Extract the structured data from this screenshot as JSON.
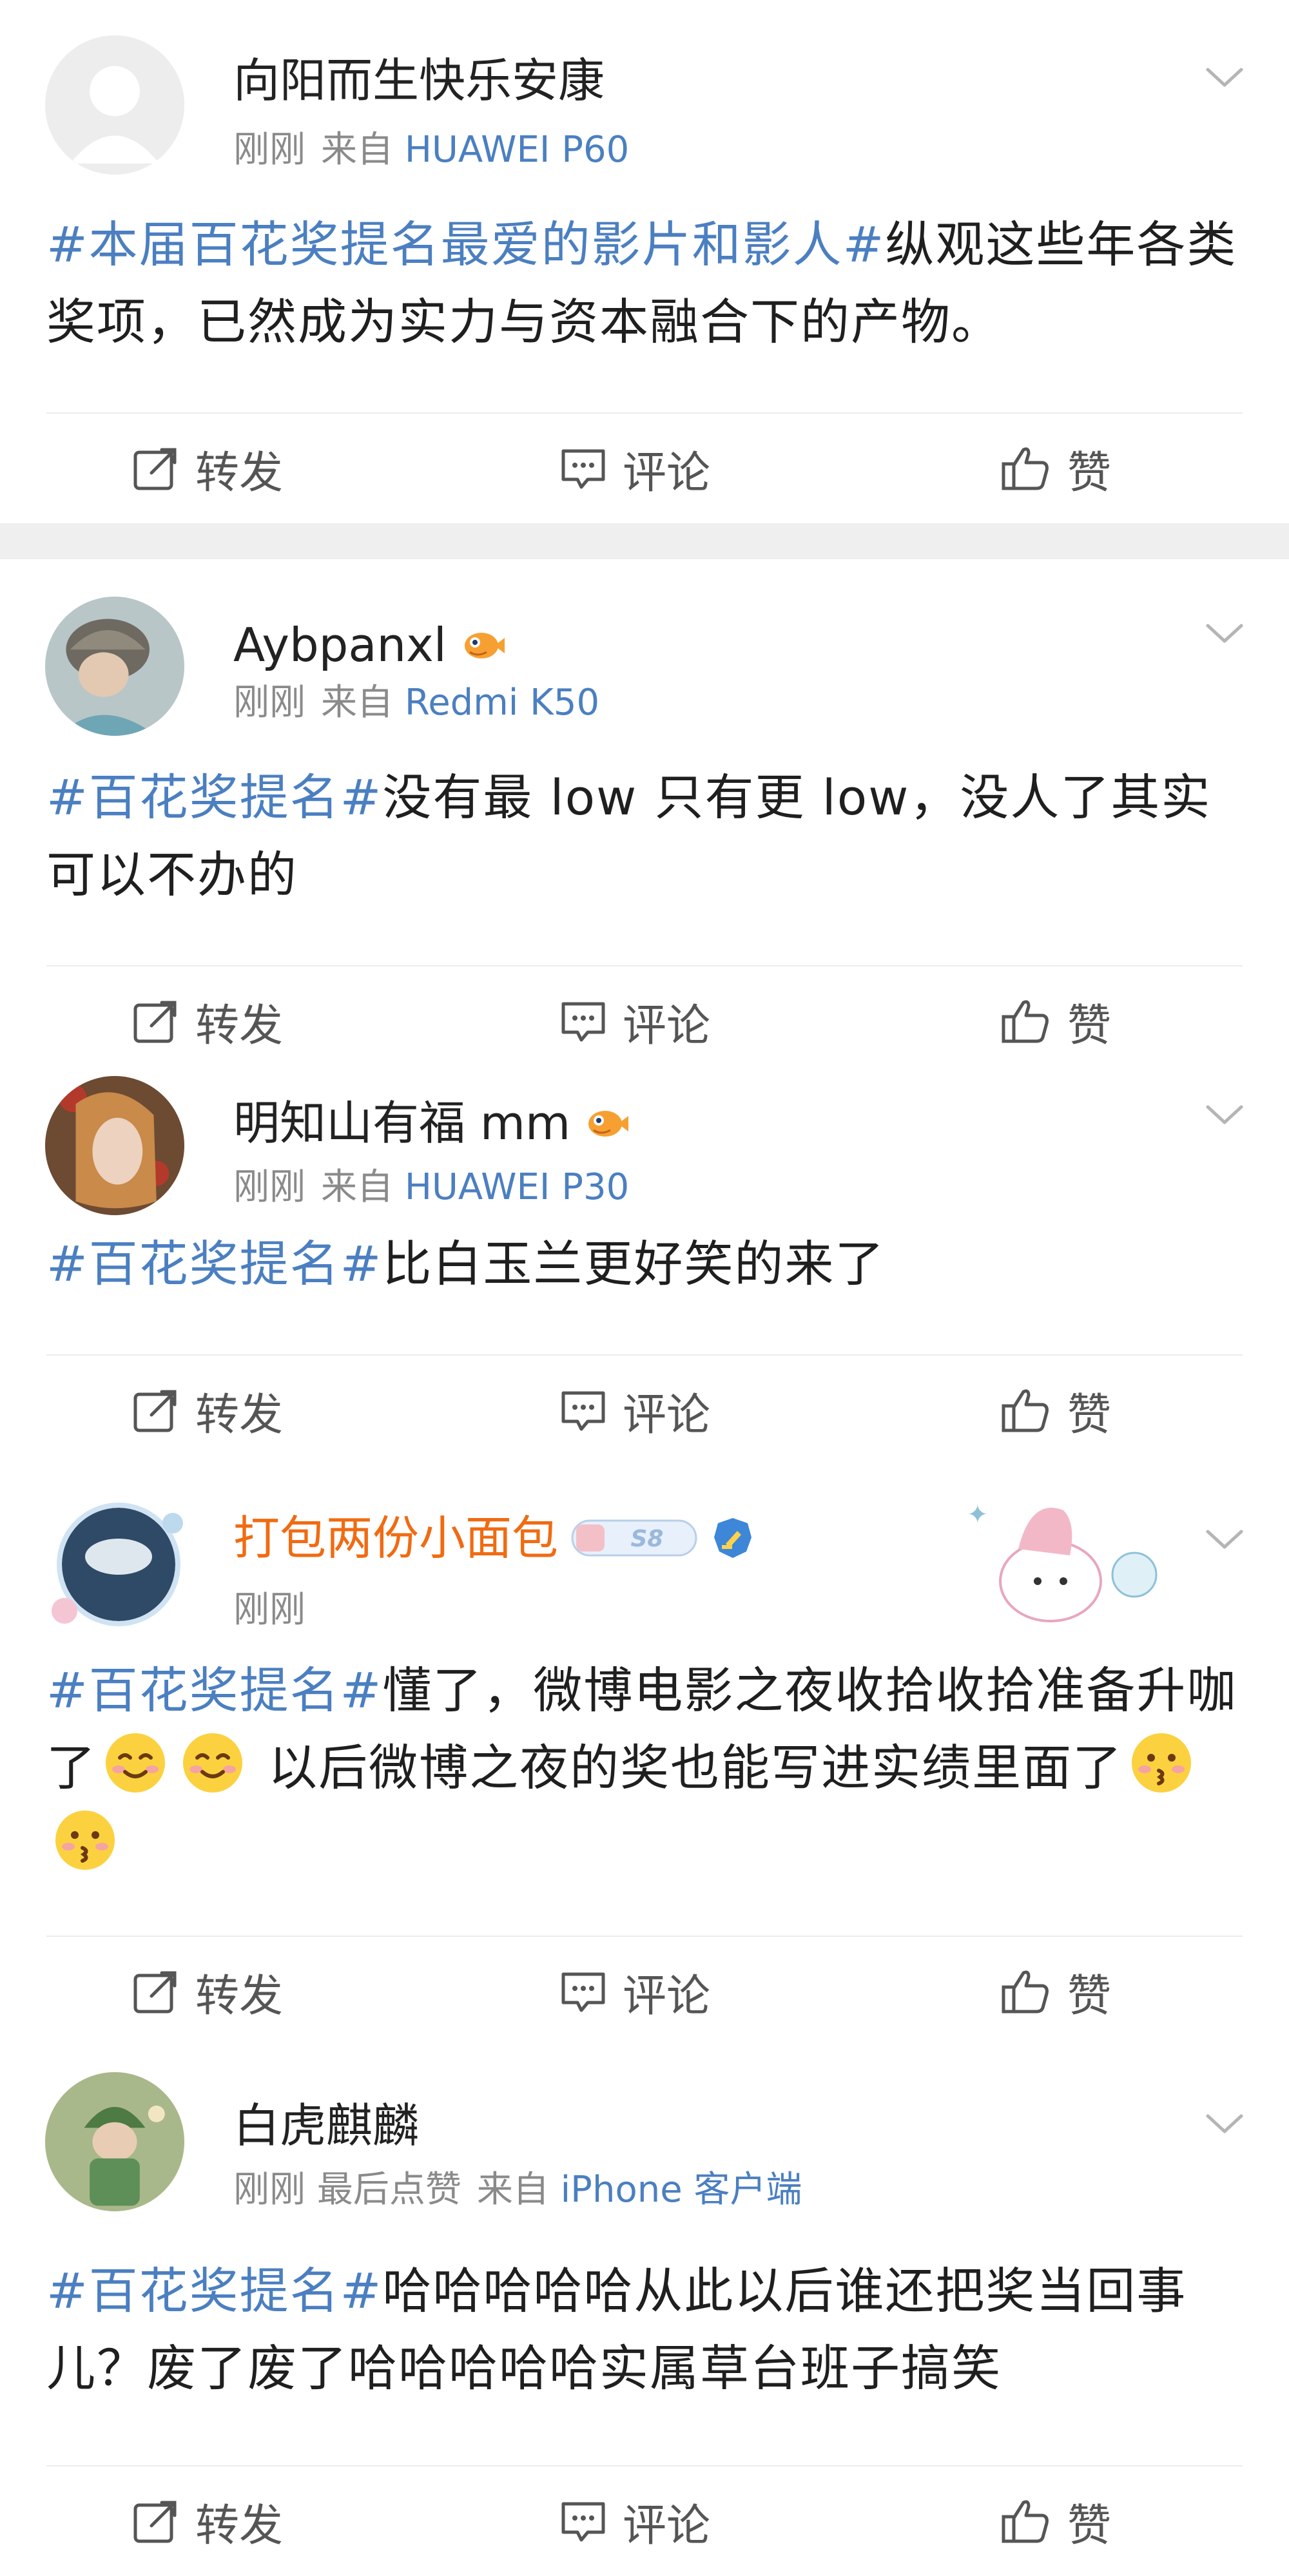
{
  "posts": [
    {
      "username": "向阳而生快乐安康",
      "time": "刚刚",
      "source_prefix": "来自",
      "device": "HUAWEI P60",
      "hashtag": "#本届百花奖提名最爱的影片和影人#",
      "text": "纵观这些年各类奖项，已然成为实力与资本融合下的产物。",
      "actions": {
        "repost": "转发",
        "comment": "评论",
        "like": "赞"
      }
    },
    {
      "username": "Aybpanxl",
      "time": "刚刚",
      "source_prefix": "来自",
      "device": "Redmi K50",
      "hashtag": "#百花奖提名#",
      "text": "没有最 low 只有更 low，没人了其实可以不办的",
      "actions": {
        "repost": "转发",
        "comment": "评论",
        "like": "赞"
      }
    },
    {
      "username": "明知山有福 mm",
      "time": "刚刚",
      "source_prefix": "来自",
      "device": "HUAWEI P30",
      "hashtag": "#百花奖提名#",
      "text": "比白玉兰更好笑的来了",
      "actions": {
        "repost": "转发",
        "comment": "评论",
        "like": "赞"
      }
    },
    {
      "username": "打包两份小面包",
      "time": "刚刚",
      "hashtag": "#百花奖提名#",
      "text_a": "懂了，微博电影之夜收拾收拾准备升咖了",
      "text_b": "以后微博之夜的奖也能写进实绩里面了",
      "vip_badge": "S8",
      "actions": {
        "repost": "转发",
        "comment": "评论",
        "like": "赞"
      }
    },
    {
      "username": "白虎麒麟",
      "time": "刚刚",
      "extra_meta": "最后点赞",
      "source_prefix": "来自",
      "device": "iPhone 客户端",
      "hashtag": "#百花奖提名#",
      "text": "哈哈哈哈哈从此以后谁还把奖当回事儿？废了废了哈哈哈哈哈实属草台班子搞笑",
      "actions": {
        "repost": "转发",
        "comment": "评论",
        "like": "赞"
      }
    }
  ],
  "colors": {
    "link": "#4b7fc1",
    "meta": "#8a8a8a",
    "member_name": "#f06b12",
    "separator_band": "#efefef"
  },
  "icons": [
    "repost-icon",
    "comment-icon",
    "like-icon",
    "chevron-down-icon",
    "fish-badge-icon",
    "verified-badge-icon",
    "smile-emoji",
    "kiss-emoji"
  ]
}
